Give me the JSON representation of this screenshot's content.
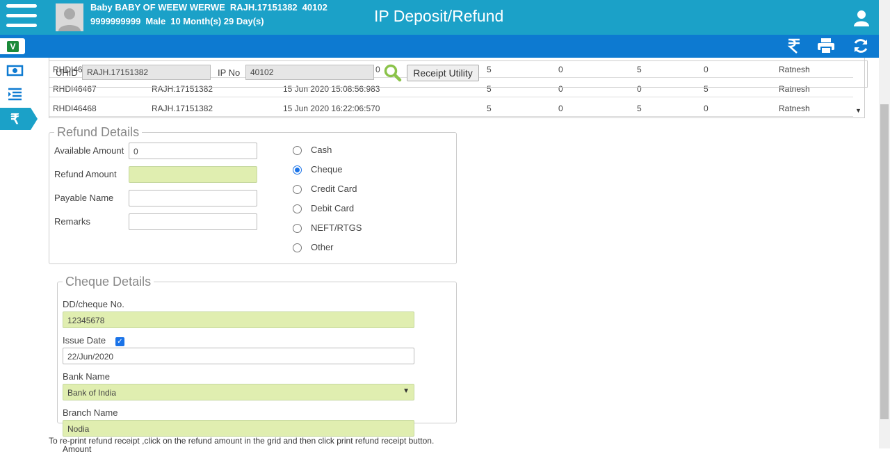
{
  "header": {
    "patient_name": "Baby BABY OF WEEW WERWE",
    "uhid": "RAJH.17151382",
    "ip_no": "40102",
    "phone": "9999999999",
    "gender": "Male",
    "age": "10 Month(s) 29 Day(s)",
    "title": "IP Deposit/Refund"
  },
  "sidebar": {
    "badge": "V",
    "active_symbol": "₹"
  },
  "toolbar": {
    "icons": [
      "rupee-icon",
      "print-icon",
      "refresh-icon"
    ]
  },
  "filter": {
    "uhid_label": "UHID",
    "uhid_value": "RAJH.17151382",
    "ipno_label": "IP No",
    "ipno_value": "40102",
    "receipt_button": "Receipt Utility"
  },
  "grid": {
    "rows": [
      [
        "RHDI46",
        "",
        "",
        "0",
        "5",
        "0",
        "5",
        "0",
        "Ratnesh"
      ],
      [
        "RHDI46467",
        "RAJH.17151382",
        "15 Jun 2020 15:08:56:983",
        "",
        "5",
        "0",
        "0",
        "5",
        "Ratnesh"
      ],
      [
        "RHDI46468",
        "RAJH.17151382",
        "15 Jun 2020 16:22:06:570",
        "",
        "5",
        "0",
        "5",
        "0",
        "Ratnesh"
      ]
    ]
  },
  "refund": {
    "legend": "Refund Details",
    "available_label": "Available Amount",
    "available_value": "0",
    "refund_label": "Refund Amount",
    "refund_value": "",
    "payable_label": "Payable Name",
    "payable_value": "",
    "remarks_label": "Remarks",
    "remarks_value": "",
    "modes": [
      "Cash",
      "Cheque",
      "Credit Card",
      "Debit Card",
      "NEFT/RTGS",
      "Other"
    ],
    "selected_mode": "Cheque"
  },
  "cheque": {
    "legend": "Cheque Details",
    "ddno_label": "DD/cheque No.",
    "ddno_value": "12345678",
    "issue_label": "Issue Date",
    "issue_checked": true,
    "issue_value": "22/Jun/2020",
    "bank_label": "Bank Name",
    "bank_value": "Bank of India",
    "branch_label": "Branch Name",
    "branch_value": "Nodia"
  },
  "footer": {
    "note": "To re-print refund receipt ,click on the refund amount in the grid and then click print refund receipt button.",
    "cutoff_label": "Amount"
  },
  "colors": {
    "topbar": "#1ba1c8",
    "subbar": "#0d7ad1",
    "field_highlight": "#e0eeb0"
  }
}
